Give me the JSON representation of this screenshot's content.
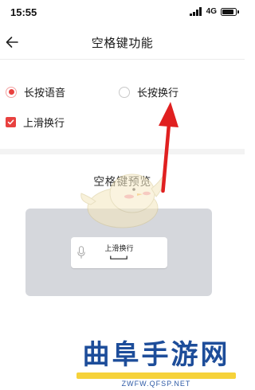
{
  "status_bar": {
    "time": "15:55",
    "network": "4G",
    "battery_level": 0.9
  },
  "header": {
    "back_icon": "back-arrow-icon",
    "title": "空格键功能"
  },
  "options": {
    "long_press_voice": {
      "label": "长按语音",
      "selected": true
    },
    "long_press_newline": {
      "label": "长按换行",
      "selected": false
    },
    "swipe_up_newline": {
      "label": "上滑换行",
      "checked": true
    }
  },
  "preview": {
    "title": "空格键预览",
    "key_label": "上滑换行",
    "key_icon": "microphone-icon"
  },
  "watermark": {
    "text": "曲阜手游网",
    "url": "ZWFW.QFSP.NET"
  },
  "colors": {
    "accent": "#e8413f",
    "preview_bg": "#d5d7dc",
    "arrow": "#e02020",
    "watermark_text": "#1d4d9a",
    "watermark_bar": "#f6d23a"
  }
}
